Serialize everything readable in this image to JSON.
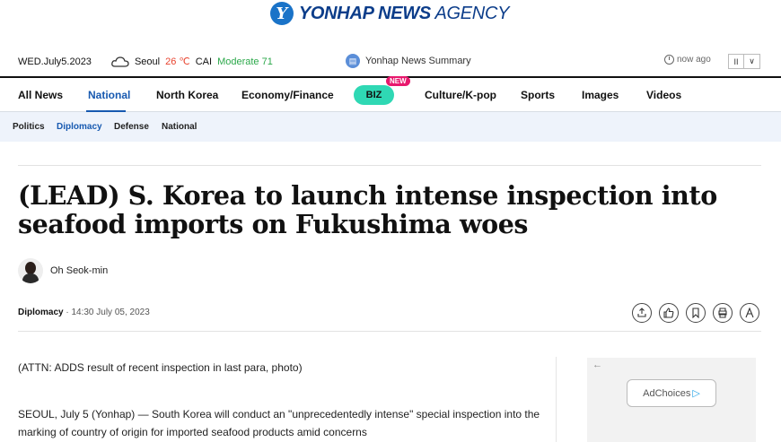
{
  "logo": {
    "bold": "YONHAP NEWS",
    "light": "AGENCY"
  },
  "infobar": {
    "date": "WED.July5.2023",
    "city": "Seoul",
    "temp": "26 ℃",
    "cai_label": "CAI",
    "cai_value": "Moderate 71",
    "summary": "Yonhap News Summary",
    "time_ago": "now ago",
    "pause": "II",
    "dropdown": "∨"
  },
  "nav": {
    "items": [
      "All News",
      "National",
      "North Korea",
      "Economy/Finance",
      "BIZ",
      "Culture/K-pop",
      "Sports",
      "Images",
      "Videos"
    ],
    "biz_badge": "NEW"
  },
  "subnav": {
    "items": [
      "Politics",
      "Diplomacy",
      "Defense",
      "National"
    ]
  },
  "article": {
    "headline": "(LEAD) S. Korea to launch intense inspection into seafood imports on Fukushima woes",
    "author": "Oh Seok-min",
    "section": "Diplomacy",
    "timestamp": "· 14:30 July 05, 2023",
    "attn": "(ATTN: ADDS result of recent inspection in last para, photo)",
    "body": "SEOUL, July 5 (Yonhap) — South Korea will conduct an \"unprecedentedly intense\" special inspection into the marking of country of origin for imported seafood products amid concerns"
  },
  "ad": {
    "label": "AdChoices",
    "arrow": "←"
  }
}
